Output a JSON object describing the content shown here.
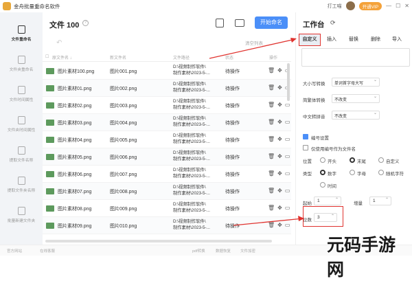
{
  "app": {
    "title": "金舟批量重命名软件",
    "user": "打工喵",
    "vip": "开通VIP",
    "win_min": "—",
    "win_max": "☐",
    "win_close": "✕"
  },
  "sidebar": {
    "items": [
      {
        "label": "文件重命名"
      },
      {
        "label": "文件夹重命名"
      },
      {
        "label": "文件时间属性"
      },
      {
        "label": "文件夹时间属性"
      },
      {
        "label": "提取文件名称"
      },
      {
        "label": "提取文件夹名称"
      },
      {
        "label": "批量新建文件夹"
      }
    ]
  },
  "main": {
    "title": "文件 100",
    "help": "?",
    "start": "开始命名",
    "clear": "清空列表",
    "undo": "↶",
    "columns": {
      "original": "原文件名 ↓",
      "new_name": "新文件名",
      "path": "文件路径",
      "status": "状态",
      "ops": "操作"
    },
    "rows": [
      {
        "original": "图片素材100.png",
        "new_name": "图片001.png",
        "path1": "D:\\视频制作软件\\",
        "path2": "制作素材\\2023-5-...",
        "status": "待操作"
      },
      {
        "original": "图片素材01.png",
        "new_name": "图片002.png",
        "path1": "D:\\视频制作软件\\",
        "path2": "制作素材\\2023-5-...",
        "status": "待操作"
      },
      {
        "original": "图片素材02.png",
        "new_name": "图片003.png",
        "path1": "D:\\视频制作软件\\",
        "path2": "制作素材\\2023-5-...",
        "status": "待操作"
      },
      {
        "original": "图片素材03.png",
        "new_name": "图片004.png",
        "path1": "D:\\视频制作软件\\",
        "path2": "制作素材\\2023-5-...",
        "status": "待操作"
      },
      {
        "original": "图片素材04.png",
        "new_name": "图片005.png",
        "path1": "D:\\视频制作软件\\",
        "path2": "制作素材\\2023-5-...",
        "status": "待操作"
      },
      {
        "original": "图片素材05.png",
        "new_name": "图片006.png",
        "path1": "D:\\视频制作软件\\",
        "path2": "制作素材\\2023-5-...",
        "status": "待操作"
      },
      {
        "original": "图片素材06.png",
        "new_name": "图片007.png",
        "path1": "D:\\视频制作软件\\",
        "path2": "制作素材\\2023-5-...",
        "status": "待操作"
      },
      {
        "original": "图片素材07.png",
        "new_name": "图片008.png",
        "path1": "D:\\视频制作软件\\",
        "path2": "制作素材\\2023-5-...",
        "status": "待操作"
      },
      {
        "original": "图片素材08.png",
        "new_name": "图片009.png",
        "path1": "D:\\视频制作软件\\",
        "path2": "制作素材\\2023-5-...",
        "status": "待操作"
      },
      {
        "original": "图片素材09.png",
        "new_name": "图片010.png",
        "path1": "D:\\视频制作软件\\",
        "path2": "制作素材\\2023-5-...",
        "status": "待操作"
      }
    ]
  },
  "panel": {
    "title": "工作台",
    "tabs": [
      "自定义",
      "插入",
      "替换",
      "删除",
      "导入"
    ],
    "case_label": "大小写转换",
    "case_value": "单词首字母大写",
    "trad_label": "简繁体转换",
    "trad_value": "不改变",
    "pinyin_label": "中文转拼音",
    "pinyin_value": "不改变",
    "numbering_label": "编号设置",
    "only_number_label": "仅使用编号作为文件名",
    "position_label": "位置",
    "pos_opts": [
      "开头",
      "末尾",
      "自定义"
    ],
    "type_label": "类型",
    "type_opts": [
      "数字",
      "字母",
      "随机字符",
      "时间"
    ],
    "start_label": "起始",
    "start_value": "1",
    "step_label": "增量",
    "step_value": "1",
    "digits_label": "位数",
    "digits_value": "3"
  },
  "footer": {
    "items": [
      "官方网站",
      "在线客服",
      "pdf转换",
      "数据恢复",
      "文件加密"
    ]
  },
  "watermark": "元码手游网",
  "colors": {
    "accent": "#4b8ff8",
    "highlight": "#e0322e"
  }
}
